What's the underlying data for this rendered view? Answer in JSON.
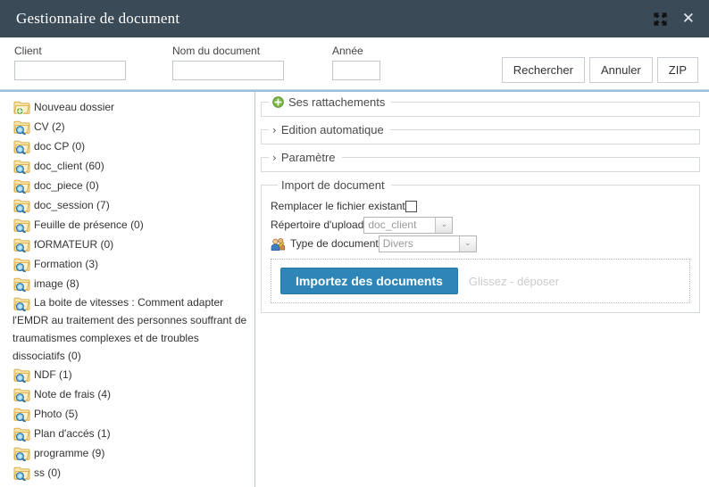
{
  "titlebar": {
    "title": "Gestionnaire de document",
    "expand_icon": "expand-arrows-icon",
    "close_icon": "close-icon",
    "close_glyph": "✕"
  },
  "search": {
    "fields": [
      {
        "label": "Client",
        "value": "",
        "placeholder": ""
      },
      {
        "label": "Nom du document",
        "value": "",
        "placeholder": ""
      },
      {
        "label": "Année",
        "value": "",
        "placeholder": ""
      }
    ],
    "buttons": [
      {
        "label": "Rechercher"
      },
      {
        "label": "Annuler"
      },
      {
        "label": "ZIP"
      }
    ]
  },
  "tree": {
    "items": [
      {
        "label": "Nouveau dossier",
        "icon": "folder-add-icon"
      },
      {
        "label": "CV (2)",
        "icon": "folder-search-icon"
      },
      {
        "label": "doc CP (0)",
        "icon": "folder-search-icon"
      },
      {
        "label": "doc_client (60)",
        "icon": "folder-search-icon"
      },
      {
        "label": "doc_piece (0)",
        "icon": "folder-search-icon"
      },
      {
        "label": "doc_session (7)",
        "icon": "folder-search-icon"
      },
      {
        "label": "Feuille de présence (0)",
        "icon": "folder-search-icon"
      },
      {
        "label": "fORMATEUR (0)",
        "icon": "folder-search-icon"
      },
      {
        "label": "Formation (3)",
        "icon": "folder-search-icon"
      },
      {
        "label": "image (8)",
        "icon": "folder-search-icon"
      },
      {
        "label": "La boite de vitesses : Comment adapter l'EMDR au traitement des personnes souffrant de traumatismes complexes et de troubles dissociatifs (0)",
        "icon": "folder-search-icon"
      },
      {
        "label": "NDF (1)",
        "icon": "folder-search-icon"
      },
      {
        "label": "Note de frais (4)",
        "icon": "folder-search-icon"
      },
      {
        "label": "Photo (5)",
        "icon": "folder-search-icon"
      },
      {
        "label": "Plan d'accés (1)",
        "icon": "folder-search-icon"
      },
      {
        "label": "programme (9)",
        "icon": "folder-search-icon"
      },
      {
        "label": "ss (0)",
        "icon": "folder-search-icon"
      }
    ]
  },
  "panels": {
    "rattachements": {
      "legend": "Ses rattachements",
      "icon": "plus-circle-icon"
    },
    "edition": {
      "legend": "Edition automatique",
      "chevron": "›"
    },
    "parametre": {
      "legend": "Paramètre",
      "chevron": "›"
    },
    "import": {
      "legend": "Import de document",
      "replace_label": "Remplacer le fichier existant",
      "replace_checked": false,
      "upload_dir_label": "Répertoire d'upload",
      "upload_dir_value": "doc_client",
      "doc_type_label": "Type de document",
      "doc_type_value": "Divers",
      "doc_type_icon": "users-icon",
      "import_button": "Importez des documents",
      "drop_hint": "Glissez - déposer",
      "arrow_glyph": "⌄"
    }
  },
  "colors": {
    "titlebar_bg": "#3b4a57",
    "accent_blue": "#2e86b8",
    "panel_border": "#d5dade",
    "top_rule": "#9bbfe0",
    "folder_yellow": "#f2cf73",
    "plus_green": "#7ab648"
  }
}
